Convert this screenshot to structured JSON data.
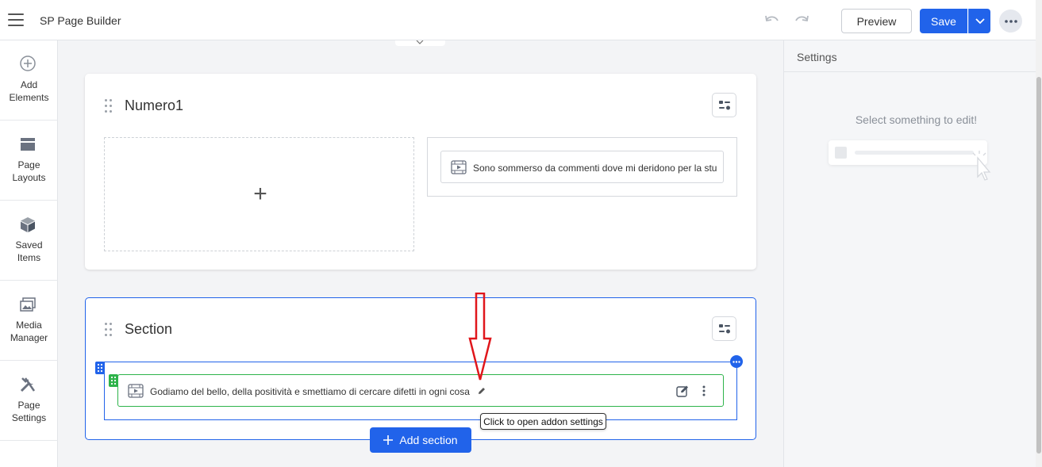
{
  "app": {
    "title": "SP Page Builder"
  },
  "toolbar": {
    "preview_label": "Preview",
    "save_label": "Save",
    "icons": [
      "hamburger-icon",
      "undo-icon",
      "redo-icon",
      "chevron-down-icon",
      "more-icon"
    ]
  },
  "sidebar": {
    "items": [
      {
        "label": "Add\nElements",
        "icon": "plus-circle-icon"
      },
      {
        "label": "Page\nLayouts",
        "icon": "layout-icon"
      },
      {
        "label": "Saved\nItems",
        "icon": "cube-icon"
      },
      {
        "label": "Media\nManager",
        "icon": "images-icon"
      },
      {
        "label": "Page\nSettings",
        "icon": "tools-icon"
      }
    ]
  },
  "canvas": {
    "sections": [
      {
        "title": "Numero1",
        "addon_text": "Sono sommerso da commenti dove mi deridono per la stu"
      },
      {
        "title": "Section",
        "addon_text": "Godiamo del bello, della positività e smettiamo di cercare difetti in ogni cosa"
      }
    ],
    "tooltip": "Click to open addon settings",
    "add_section_label": "Add section"
  },
  "settings": {
    "title": "Settings",
    "empty_message": "Select something to edit!"
  },
  "colors": {
    "primary": "#2163ea",
    "addon_border": "#2db34a",
    "annotation_arrow": "#e0161b"
  }
}
